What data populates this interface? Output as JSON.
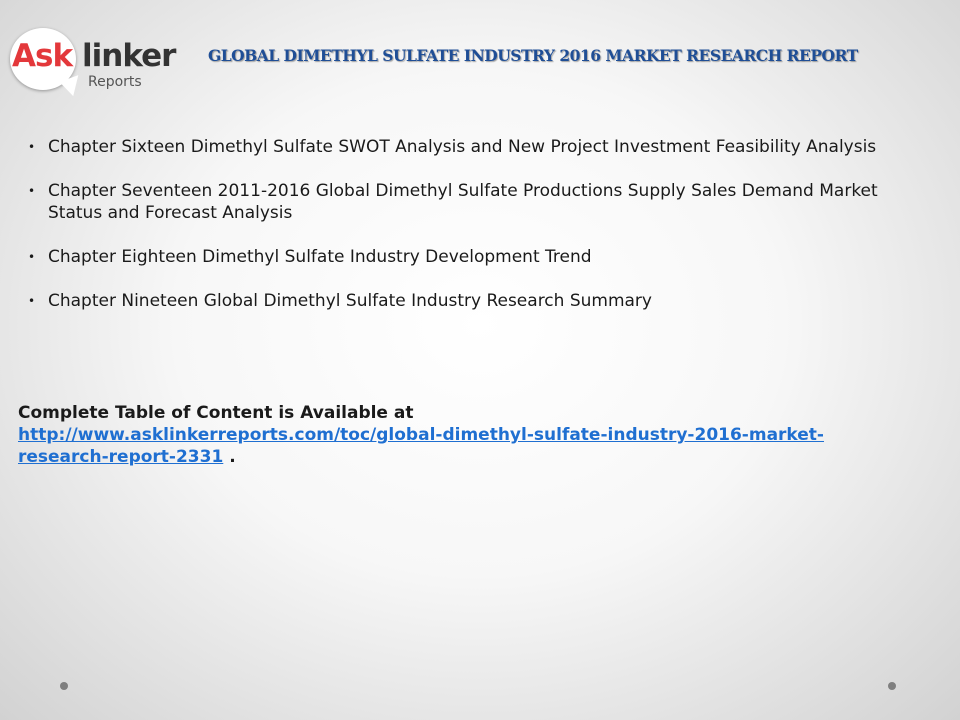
{
  "logo": {
    "ask": "Ask",
    "linker": "linker",
    "reports": "Reports"
  },
  "header": {
    "title": "GLOBAL DIMETHYL SULFATE INDUSTRY 2016 MARKET RESEARCH REPORT"
  },
  "bullets": [
    "Chapter Sixteen Dimethyl Sulfate SWOT Analysis and New Project Investment Feasibility Analysis",
    "Chapter Seventeen 2011-2016 Global Dimethyl Sulfate Productions Supply Sales Demand Market Status and Forecast Analysis",
    "Chapter Eighteen Dimethyl Sulfate Industry Development Trend",
    "Chapter Nineteen Global Dimethyl Sulfate Industry Research Summary"
  ],
  "bullet_glyph": "•",
  "toc": {
    "label": "Complete Table of Content is Available at",
    "link_text": "http://www.asklinkerreports.com/toc/global-dimethyl-sulfate-industry-2016-market-research-report-2331",
    "suffix": " ."
  },
  "colors": {
    "brand_red": "#e3383b",
    "header_blue": "#1f4e96",
    "link_blue": "#1f6fd1"
  }
}
